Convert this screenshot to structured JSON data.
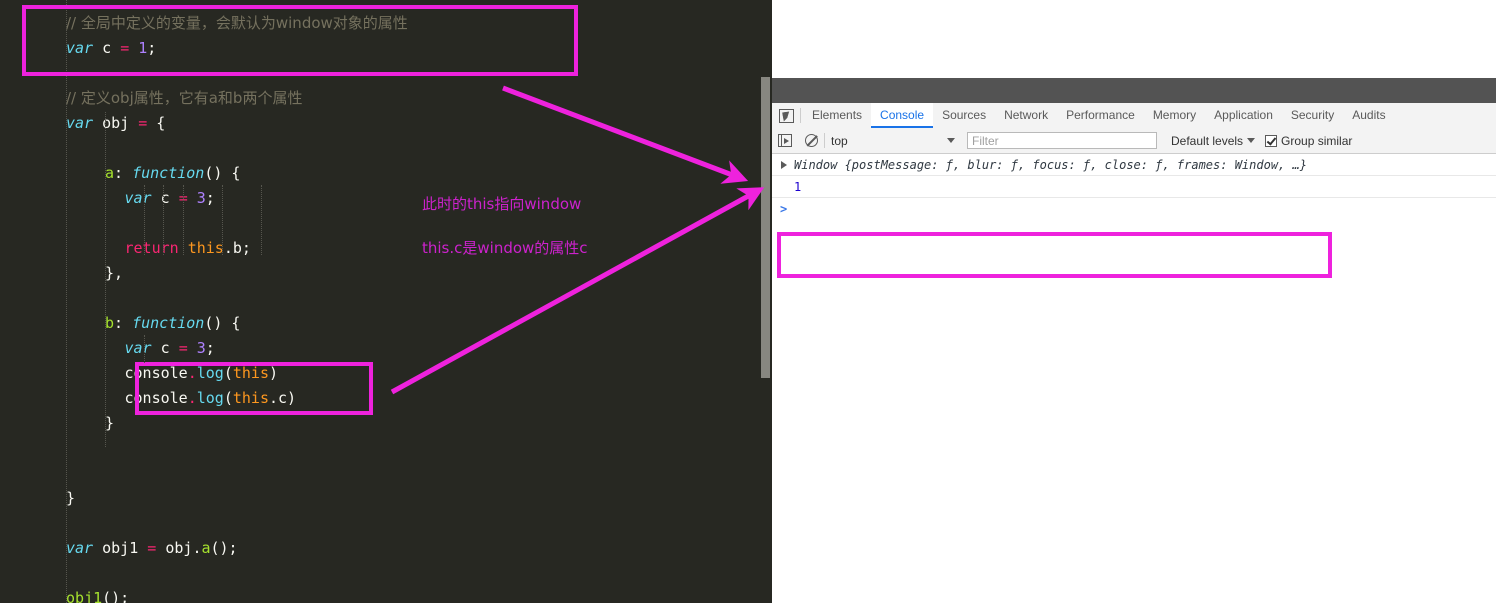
{
  "editor": {
    "lines": [
      {
        "indent": 0,
        "tokens": [
          {
            "c": "t-com",
            "t": "// 全局中定义的变量，会默认为window对象的属性"
          }
        ]
      },
      {
        "indent": 0,
        "tokens": [
          {
            "c": "t-kw",
            "t": "var"
          },
          {
            "c": "t-var",
            "t": " c "
          },
          {
            "c": "t-op",
            "t": "="
          },
          {
            "c": "t-num",
            "t": " 1"
          },
          {
            "c": "t-punct",
            "t": ";"
          }
        ]
      },
      {
        "indent": 0,
        "tokens": []
      },
      {
        "indent": 0,
        "tokens": [
          {
            "c": "t-com",
            "t": "// 定义obj属性，它有a和b两个属性"
          }
        ]
      },
      {
        "indent": 0,
        "tokens": [
          {
            "c": "t-kw",
            "t": "var"
          },
          {
            "c": "t-var",
            "t": " obj "
          },
          {
            "c": "t-op",
            "t": "="
          },
          {
            "c": "t-punct",
            "t": " {"
          }
        ]
      },
      {
        "indent": 0,
        "tokens": []
      },
      {
        "indent": 2,
        "tokens": [
          {
            "c": "t-prop",
            "t": "a"
          },
          {
            "c": "t-punct",
            "t": ": "
          },
          {
            "c": "t-fn",
            "t": "function"
          },
          {
            "c": "t-punct",
            "t": "() {"
          }
        ]
      },
      {
        "indent": 3,
        "tokens": [
          {
            "c": "t-kw",
            "t": "var"
          },
          {
            "c": "t-var",
            "t": " c "
          },
          {
            "c": "t-op",
            "t": "="
          },
          {
            "c": "t-num",
            "t": " 3"
          },
          {
            "c": "t-punct",
            "t": ";"
          }
        ]
      },
      {
        "indent": 3,
        "tokens": []
      },
      {
        "indent": 3,
        "tokens": [
          {
            "c": "t-ret",
            "t": "return"
          },
          {
            "c": "t-this",
            "t": " this"
          },
          {
            "c": "t-punct",
            "t": ".b;"
          }
        ]
      },
      {
        "indent": 2,
        "tokens": [
          {
            "c": "t-punct",
            "t": "},"
          }
        ]
      },
      {
        "indent": 0,
        "tokens": []
      },
      {
        "indent": 2,
        "tokens": [
          {
            "c": "t-prop",
            "t": "b"
          },
          {
            "c": "t-punct",
            "t": ": "
          },
          {
            "c": "t-fn",
            "t": "function"
          },
          {
            "c": "t-punct",
            "t": "() {"
          }
        ]
      },
      {
        "indent": 3,
        "tokens": [
          {
            "c": "t-kw",
            "t": "var"
          },
          {
            "c": "t-var",
            "t": " c "
          },
          {
            "c": "t-op",
            "t": "="
          },
          {
            "c": "t-num",
            "t": " 3"
          },
          {
            "c": "t-punct",
            "t": ";"
          }
        ]
      },
      {
        "indent": 3,
        "tokens": [
          {
            "c": "t-obj",
            "t": "console"
          },
          {
            "c": "t-dot",
            "t": "."
          },
          {
            "c": "t-meth",
            "t": "log"
          },
          {
            "c": "t-punct",
            "t": "("
          },
          {
            "c": "t-this",
            "t": "this"
          },
          {
            "c": "t-punct",
            "t": ")"
          }
        ]
      },
      {
        "indent": 3,
        "tokens": [
          {
            "c": "t-obj",
            "t": "console"
          },
          {
            "c": "t-dot",
            "t": "."
          },
          {
            "c": "t-meth",
            "t": "log"
          },
          {
            "c": "t-punct",
            "t": "("
          },
          {
            "c": "t-this",
            "t": "this"
          },
          {
            "c": "t-punct",
            "t": ".c)"
          }
        ]
      },
      {
        "indent": 2,
        "tokens": [
          {
            "c": "t-punct",
            "t": "}"
          }
        ]
      },
      {
        "indent": 0,
        "tokens": []
      },
      {
        "indent": 0,
        "tokens": []
      },
      {
        "indent": 0,
        "tokens": [
          {
            "c": "t-punct",
            "t": "}"
          }
        ]
      },
      {
        "indent": 0,
        "tokens": []
      },
      {
        "indent": 0,
        "tokens": [
          {
            "c": "t-kw",
            "t": "var"
          },
          {
            "c": "t-var",
            "t": " obj1 "
          },
          {
            "c": "t-op",
            "t": "="
          },
          {
            "c": "t-var",
            "t": " obj"
          },
          {
            "c": "t-punct",
            "t": "."
          },
          {
            "c": "t-call",
            "t": "a"
          },
          {
            "c": "t-punct",
            "t": "();"
          }
        ]
      },
      {
        "indent": 0,
        "tokens": []
      },
      {
        "indent": 0,
        "tokens": [
          {
            "c": "t-call",
            "t": "obj1"
          },
          {
            "c": "t-punct",
            "t": "();"
          }
        ]
      }
    ],
    "annotations": [
      {
        "id": "annot1",
        "text": "此时的this指向window"
      },
      {
        "id": "annot2",
        "text": "this.c是window的属性c"
      }
    ],
    "highlight_color": "#ee22dd",
    "background_color": "#272822",
    "annotation_color": "#cc22cc"
  },
  "devtools": {
    "tabs": [
      {
        "label": "Elements",
        "active": false
      },
      {
        "label": "Console",
        "active": true
      },
      {
        "label": "Sources",
        "active": false
      },
      {
        "label": "Network",
        "active": false
      },
      {
        "label": "Performance",
        "active": false
      },
      {
        "label": "Memory",
        "active": false
      },
      {
        "label": "Application",
        "active": false
      },
      {
        "label": "Security",
        "active": false
      },
      {
        "label": "Audits",
        "active": false
      }
    ],
    "toolbar": {
      "context_value": "top",
      "filter_placeholder": "Filter",
      "filter_value": "",
      "levels_label": "Default levels",
      "group_similar_label": "Group similar",
      "group_similar_checked": true
    },
    "console_messages": [
      {
        "type": "object",
        "expandable": true,
        "text": "Window {postMessage: ƒ, blur: ƒ, focus: ƒ, close: ƒ, frames: Window, …}"
      },
      {
        "type": "number",
        "expandable": false,
        "text": "1"
      }
    ],
    "prompt": ">",
    "accent_color": "#1a73e8"
  }
}
